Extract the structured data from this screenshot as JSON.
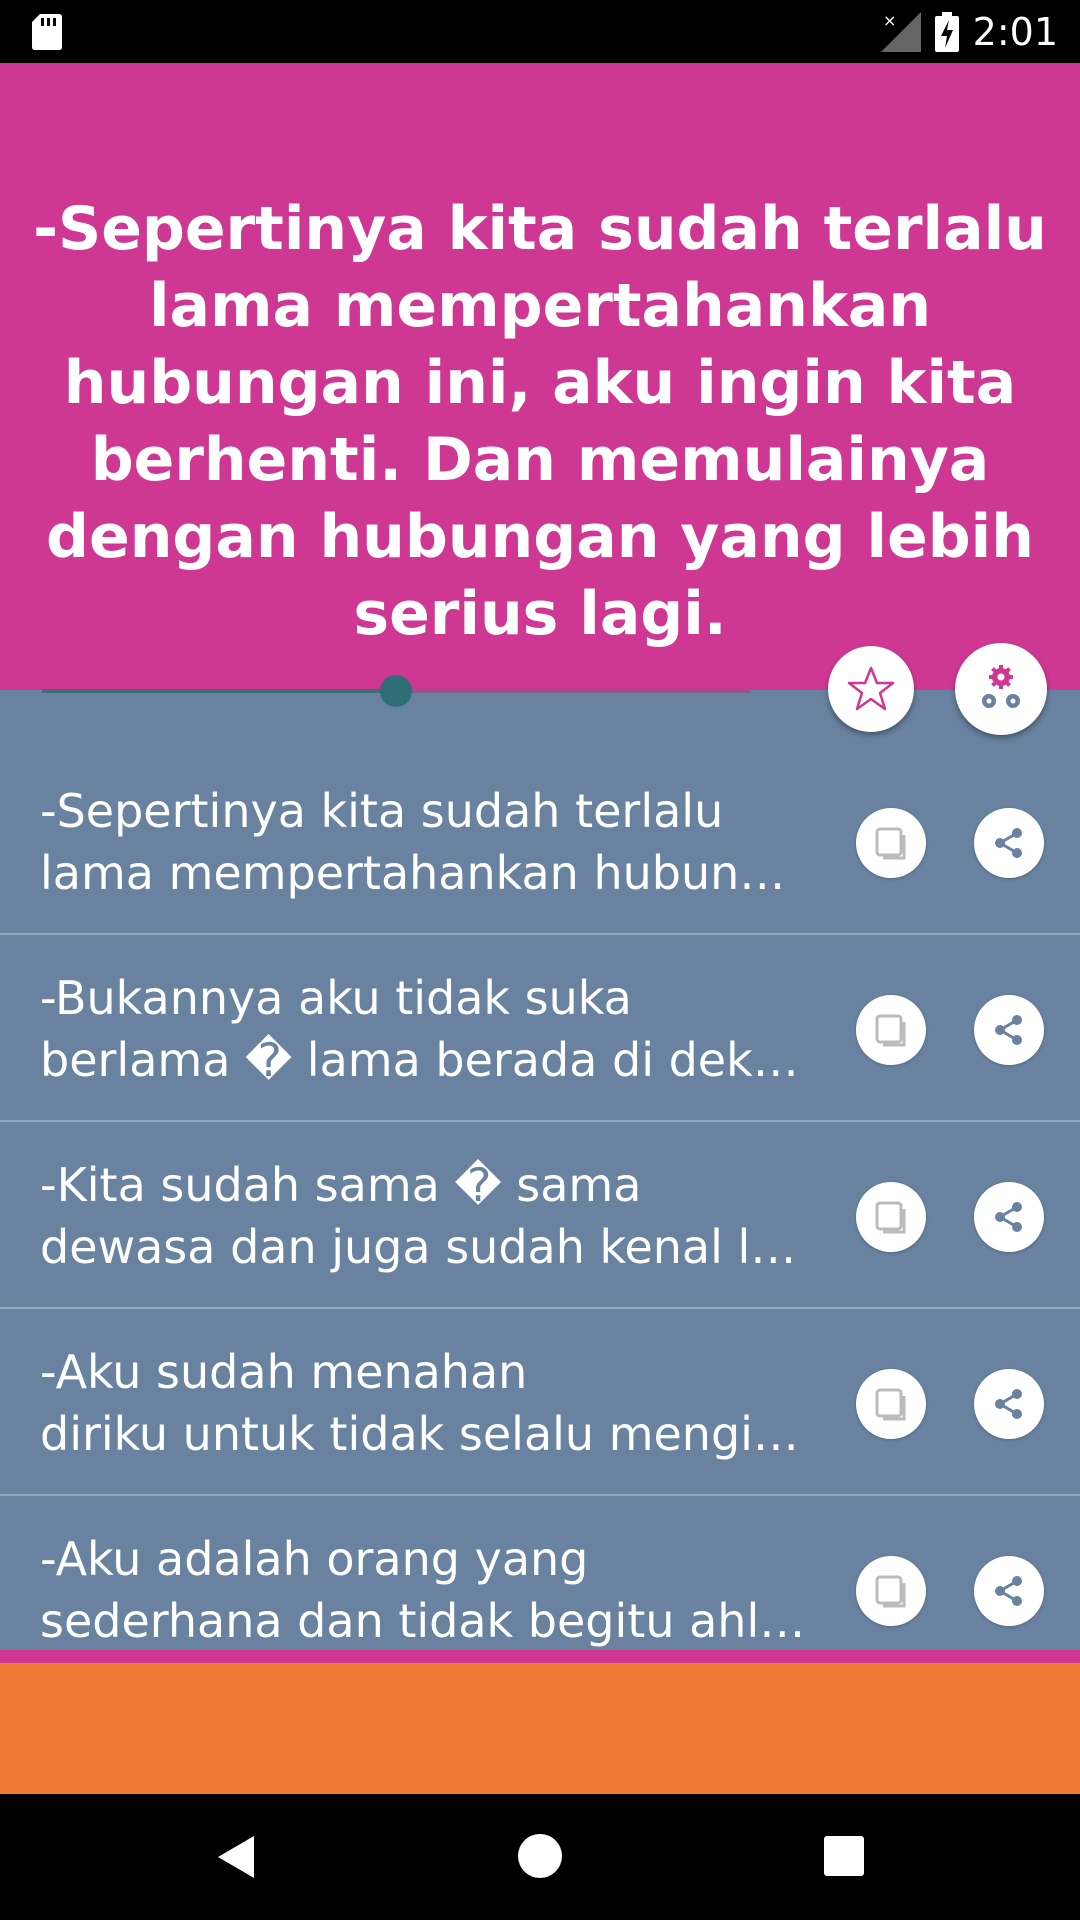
{
  "status_bar": {
    "time": "2:01"
  },
  "header": {
    "quote": "-Sepertinya kita sudah terlalu lama mempertahankan hubungan ini, aku ingin kita berhenti. Dan memulainya dengan hubungan yang lebih serius lagi.",
    "progress": 0.5
  },
  "quotes_list": [
    {
      "line1": "-Sepertinya kita sudah terlalu",
      "line2": "lama mempertahankan hubun…"
    },
    {
      "line1": "-Bukannya aku tidak suka",
      "line2": "berlama � lama berada di dek…"
    },
    {
      "line1": "-Kita sudah sama � sama",
      "line2": "dewasa dan juga sudah kenal l…"
    },
    {
      "line1": "-Aku sudah menahan",
      "line2": "diriku untuk tidak selalu mengi…"
    },
    {
      "line1": "-Aku adalah orang yang",
      "line2": "sederhana dan tidak begitu ahl…"
    }
  ],
  "icons": {
    "favorite": "star-icon",
    "settings": "gear-icon",
    "copy": "copy-icon",
    "share": "share-icon"
  },
  "colors": {
    "header_bg": "#CF3892",
    "list_bg": "#6882A0",
    "ad_bg": "#F07A35"
  }
}
